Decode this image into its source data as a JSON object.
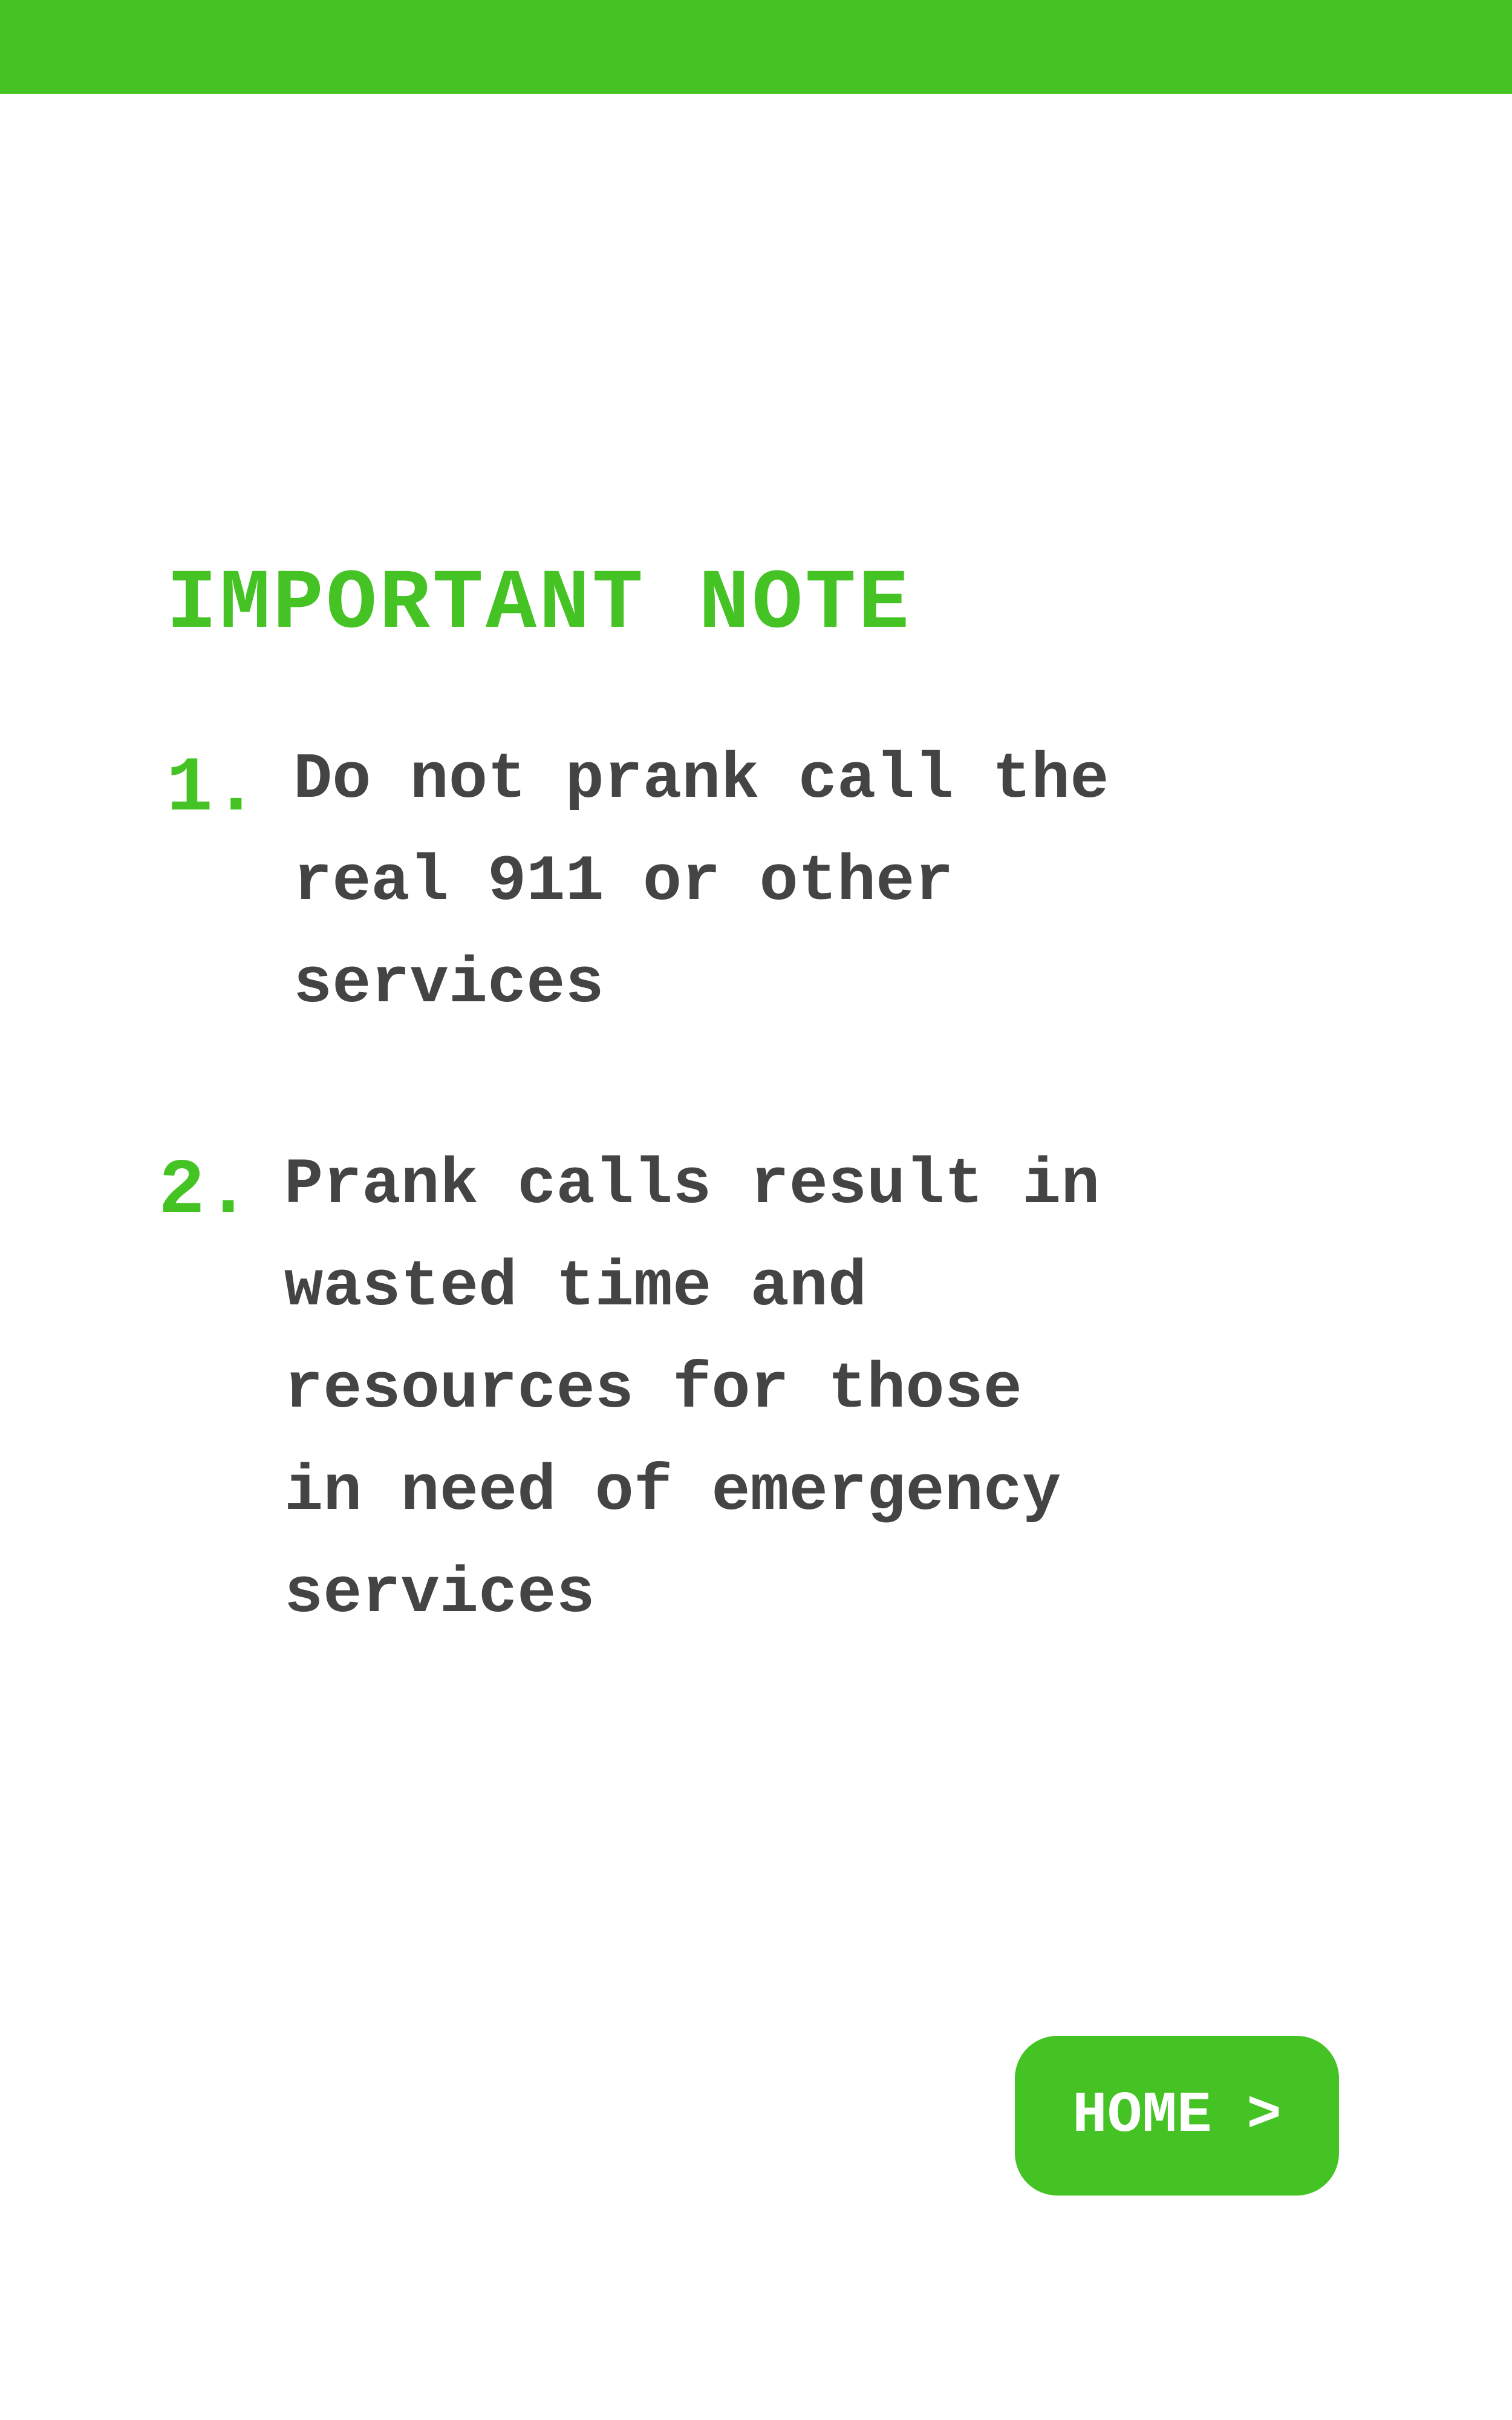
{
  "theme": {
    "accent": "#45c325",
    "text": "#444444",
    "background": "#ffffff"
  },
  "header": {
    "title": "IMPORTANT NOTE"
  },
  "notes": [
    {
      "number": "1.",
      "lines": [
        "Do not prank call the",
        "real 911 or other",
        "services"
      ]
    },
    {
      "number": "2.",
      "lines": [
        "Prank calls result in",
        "wasted time and",
        "resources for those",
        "in need of emergency",
        "services"
      ]
    }
  ],
  "home_button": {
    "label": "HOME >"
  }
}
